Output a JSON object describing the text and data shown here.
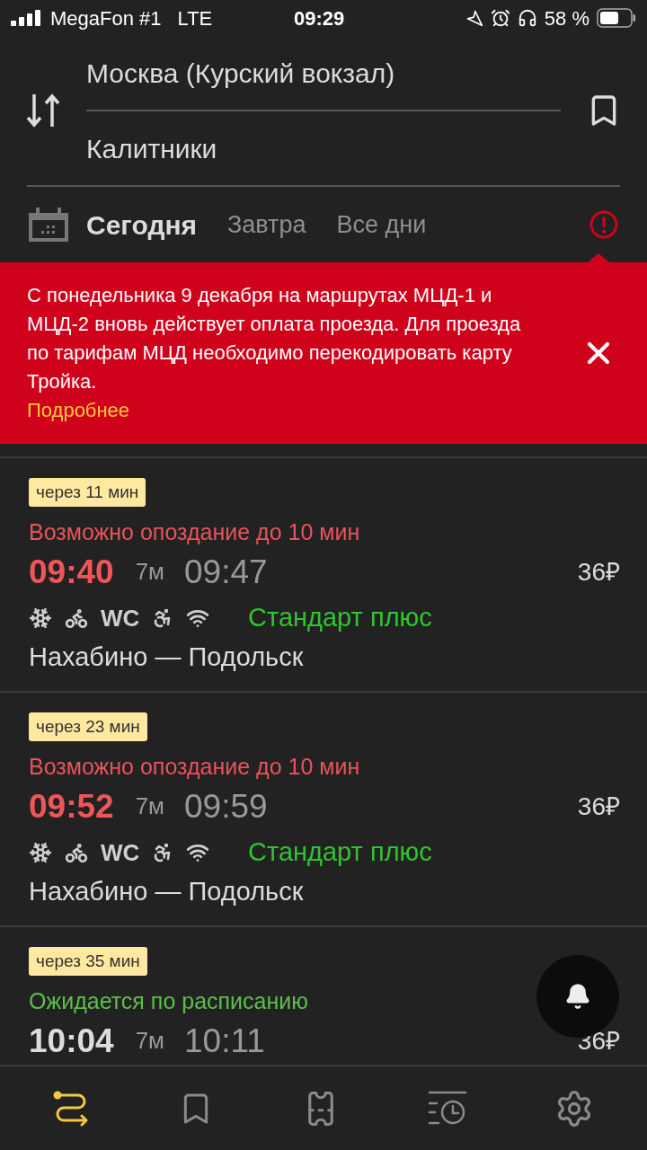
{
  "status_bar": {
    "carrier": "MegaFon #1",
    "network": "LTE",
    "time": "09:29",
    "battery": "58 %"
  },
  "route": {
    "from": "Москва (Курский вокзал)",
    "to": "Калитники"
  },
  "date_tabs": [
    {
      "label": "Сегодня",
      "selected": true
    },
    {
      "label": "Завтра",
      "selected": false
    },
    {
      "label": "Все дни",
      "selected": false
    }
  ],
  "alert": {
    "text": "С понедельника 9 декабря на маршрутах МЦД-1 и МЦД-2 вновь действует оплата проезда. Для проезда по тарифам МЦД необходимо перекодировать карту Тройка.",
    "link": "Подробнее"
  },
  "trains": [
    {
      "countdown": "через 11 мин",
      "status": "Возможно опоздание до 10 мин",
      "kind": "delayed",
      "departure": "09:40",
      "duration": "7м",
      "arrival": "09:47",
      "price": "36₽",
      "amenities": [
        {
          "kind": "climate"
        },
        {
          "kind": "bicycle"
        },
        {
          "kind": "text",
          "label": "WC"
        },
        {
          "kind": "accessible"
        },
        {
          "kind": "wifi"
        }
      ],
      "category": "Стандарт плюс",
      "route": "Нахабино — Подольск"
    },
    {
      "countdown": "через 23 мин",
      "status": "Возможно опоздание до 10 мин",
      "kind": "delayed",
      "departure": "09:52",
      "duration": "7м",
      "arrival": "09:59",
      "price": "36₽",
      "amenities": [
        {
          "kind": "climate"
        },
        {
          "kind": "bicycle"
        },
        {
          "kind": "text",
          "label": "WC"
        },
        {
          "kind": "accessible"
        },
        {
          "kind": "wifi"
        }
      ],
      "category": "Стандарт плюс",
      "route": "Нахабино — Подольск"
    },
    {
      "countdown": "через 35 мин",
      "status": "Ожидается по расписанию",
      "kind": "on_time",
      "departure": "10:04",
      "duration": "7м",
      "arrival": "10:11",
      "price": "36₽"
    }
  ],
  "bottom_nav": [
    {
      "kind": "routes",
      "selected": true
    },
    {
      "kind": "bookmarks",
      "selected": false
    },
    {
      "kind": "tickets",
      "selected": false
    },
    {
      "kind": "history",
      "selected": false
    },
    {
      "kind": "settings",
      "selected": false
    }
  ]
}
